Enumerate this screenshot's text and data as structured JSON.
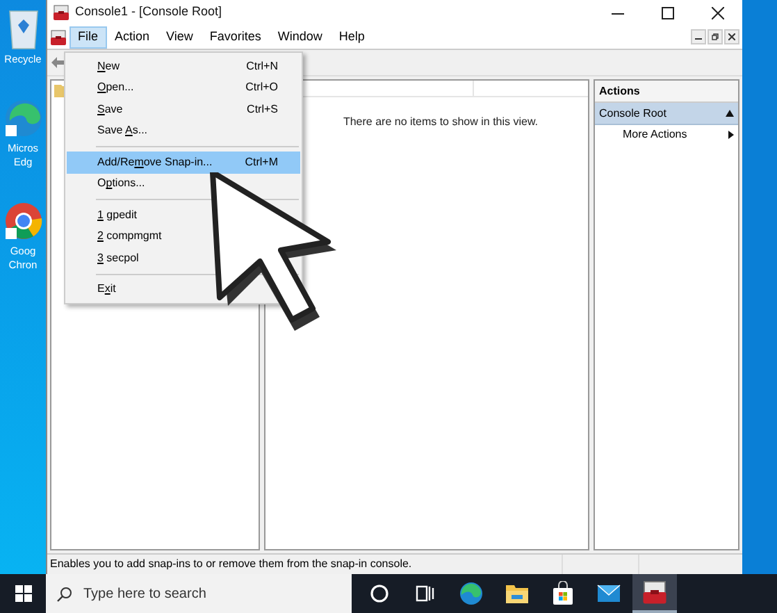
{
  "desktop_icons": [
    {
      "kind": "recycle",
      "lines": [
        "Recycle"
      ]
    },
    {
      "kind": "edge",
      "lines": [
        "Micros",
        "Edg"
      ]
    },
    {
      "kind": "chrome",
      "lines": [
        "Goog",
        "Chron"
      ]
    }
  ],
  "window": {
    "title": "Console1 - [Console Root]"
  },
  "menu_bar": [
    {
      "label": "File",
      "selected": true
    },
    {
      "label": "Action",
      "selected": false
    },
    {
      "label": "View",
      "selected": false
    },
    {
      "label": "Favorites",
      "selected": false
    },
    {
      "label": "Window",
      "selected": false
    },
    {
      "label": "Help",
      "selected": false
    }
  ],
  "file_menu": [
    {
      "kind": "item",
      "key": "N",
      "after": "ew",
      "shortcut": "Ctrl+N",
      "selected": false
    },
    {
      "kind": "item",
      "key": "O",
      "after": "pen...",
      "shortcut": "Ctrl+O",
      "selected": false
    },
    {
      "kind": "item",
      "key": "S",
      "after": "ave",
      "shortcut": "Ctrl+S",
      "selected": false
    },
    {
      "kind": "item",
      "before": "Save ",
      "key": "A",
      "after": "s...",
      "selected": false
    },
    {
      "kind": "separator"
    },
    {
      "kind": "item",
      "before": "Add/Re",
      "key": "m",
      "after": "ove Snap-in...",
      "shortcut": "Ctrl+M",
      "selected": true
    },
    {
      "kind": "item",
      "before": "O",
      "key": "p",
      "after": "tions...",
      "selected": false
    },
    {
      "kind": "separator"
    },
    {
      "kind": "item",
      "key": "1",
      "after": " gpedit",
      "selected": false
    },
    {
      "kind": "item",
      "key": "2",
      "after": " compmgmt",
      "selected": false
    },
    {
      "kind": "item",
      "key": "3",
      "after": " secpol",
      "selected": false
    },
    {
      "kind": "separator"
    },
    {
      "kind": "item",
      "before": "E",
      "key": "x",
      "after": "it",
      "selected": false
    }
  ],
  "content": {
    "empty_message": "There are no items to show in this view."
  },
  "actions": {
    "header": "Actions",
    "section": {
      "label": "Console Root",
      "expanded": true
    },
    "items": [
      {
        "label": "More Actions"
      }
    ]
  },
  "status_bar": "Enables you to add snap-ins to or remove them from the snap-in console.",
  "taskbar": {
    "search_placeholder": "Type here to search",
    "apps": [
      {
        "kind": "cortana",
        "selected": false
      },
      {
        "kind": "taskview",
        "selected": false
      },
      {
        "kind": "edge",
        "selected": false
      },
      {
        "kind": "explorer",
        "selected": false
      },
      {
        "kind": "store",
        "selected": false
      },
      {
        "kind": "mail",
        "selected": false
      },
      {
        "kind": "mmc",
        "selected": true
      }
    ]
  }
}
